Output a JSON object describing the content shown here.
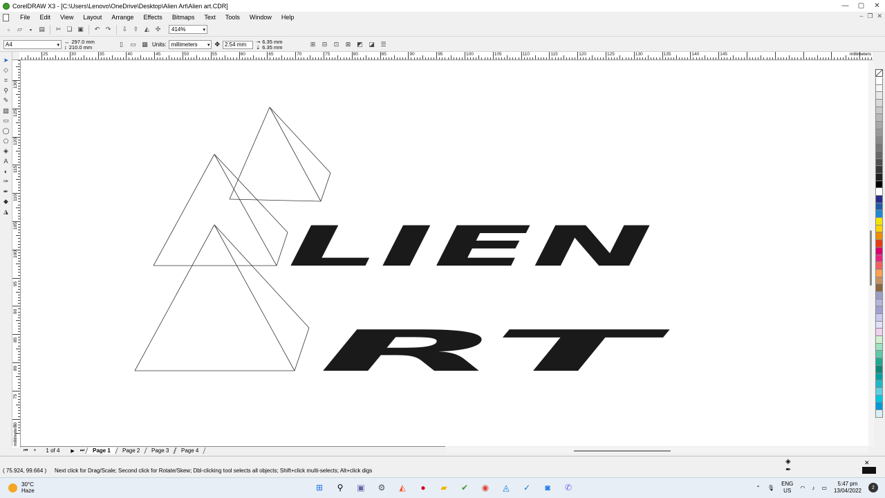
{
  "window": {
    "title": "CorelDRAW X3 - [C:\\Users\\Lenovo\\OneDrive\\Desktop\\Alien Art\\Alien art.CDR]",
    "minimize": "—",
    "maximize": "▢",
    "close": "✕"
  },
  "menu": {
    "items": [
      "File",
      "Edit",
      "View",
      "Layout",
      "Arrange",
      "Effects",
      "Bitmaps",
      "Text",
      "Tools",
      "Window",
      "Help"
    ]
  },
  "toolbar": {
    "zoom": "414%"
  },
  "propbar": {
    "paper": "A4",
    "width": "297.0 mm",
    "height": "210.0 mm",
    "units_label": "Units:",
    "units_value": "millimeters",
    "nudge": "2.54 mm",
    "dup_x": "6.35 mm",
    "dup_y": "6.35 mm"
  },
  "rulers": {
    "h_labels": [
      "25",
      "30",
      "35",
      "40",
      "45",
      "50",
      "55",
      "60",
      "65",
      "70",
      "75",
      "80",
      "85",
      "90",
      "95",
      "100",
      "105",
      "110",
      "115",
      "120",
      "125",
      "130",
      "135",
      "140",
      "145"
    ],
    "h_unit": "millimeters",
    "v_labels": [
      "130",
      "125",
      "120",
      "115",
      "110",
      "105",
      "100",
      "95",
      "90",
      "85",
      "80",
      "75",
      "70"
    ],
    "v_unit": "millimeters"
  },
  "canvas": {
    "word1": "LIEN",
    "word2": "RT"
  },
  "palette": {
    "colors": [
      "#ffffff",
      "#f5f5f5",
      "#e8e8e8",
      "#d8d8d8",
      "#c8c8c8",
      "#b8b8b8",
      "#a8a8a8",
      "#989898",
      "#888888",
      "#787878",
      "#686868",
      "#505050",
      "#383838",
      "#202020",
      "#000000",
      "#ffffff",
      "#2b2b8c",
      "#1e5aa8",
      "#1e88d0",
      "#f2e600",
      "#ffd400",
      "#f08c00",
      "#e83a14",
      "#d8006e",
      "#e52680",
      "#f06060",
      "#ffa050",
      "#c89060",
      "#8c6440",
      "#9c9cc8",
      "#b4b4dc",
      "#a0a0d0",
      "#c8c8f0",
      "#e0e0f8",
      "#f0d0f0",
      "#d0f0d0",
      "#a0e0c0",
      "#60c8a8",
      "#20a890",
      "#108878",
      "#00a0a0",
      "#20b8c8",
      "#60d0e0",
      "#00c8e0",
      "#0098d8",
      "#d8f0f8"
    ]
  },
  "pages": {
    "count": "1 of 4",
    "tabs": [
      "Page 1",
      "Page 2",
      "Page 3",
      "Page 4"
    ]
  },
  "status": {
    "coords": "( 75.924, 99.664 )",
    "hint": "Next click for Drag/Scale; Second click for Rotate/Skew; Dbl-clicking tool selects all objects; Shift+click multi-selects; Alt+click digs"
  },
  "taskbar": {
    "temp": "30°C",
    "weather": "Haze",
    "lang1": "ENG",
    "lang2": "US",
    "time": "5:47 pm",
    "date": "13/04/2022",
    "notif": "2"
  }
}
